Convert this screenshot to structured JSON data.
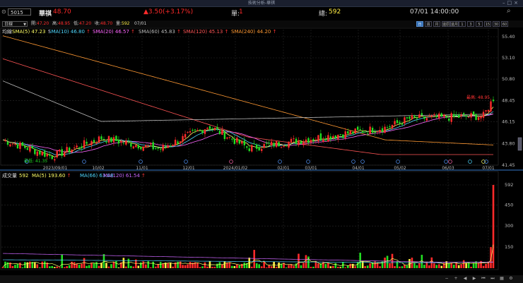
{
  "window": {
    "title": "技術分析-華祺"
  },
  "info": {
    "code": "5015",
    "name": "華祺",
    "price": "48.70",
    "change": "▲3.50(+3.17%)",
    "volume_label": "單:",
    "volume": "1",
    "total_label": "總:",
    "total": "592",
    "datetime": "07/01 14:00:00"
  },
  "ohlc": {
    "open_label": "開:",
    "open": "47.20",
    "high_label": "高:",
    "high": "48.95",
    "low_label": "低:",
    "low": "47.20",
    "close_label": "收:",
    "close": "48.70",
    "qty_label": "量:",
    "qty": "592",
    "date": "07/01"
  },
  "period": {
    "selected": "日線",
    "buttons": [
      "日",
      "週",
      "月",
      "還原",
      "還月",
      "1",
      "3",
      "5",
      "15",
      "30",
      "60"
    ],
    "active_index": 0
  },
  "ma_legend": {
    "label": "均線",
    "items": [
      {
        "text": "SMA(5) 47.23",
        "arrow": "↑",
        "color": "#ffff66"
      },
      {
        "text": "SMA(10) 46.80",
        "arrow": "↑",
        "color": "#4fd8ff"
      },
      {
        "text": "SMA(20) 46.57",
        "arrow": "↑",
        "color": "#ff66ff"
      },
      {
        "text": "SMA(60) 45.83",
        "arrow": "↑",
        "color": "#bbbbbb"
      },
      {
        "text": "SMA(120) 45.13",
        "arrow": "↑",
        "color": "#ff5555"
      },
      {
        "text": "SMA(240) 44.20",
        "arrow": "↑",
        "color": "#ff9933"
      }
    ]
  },
  "vol_legend": {
    "label": "成交量",
    "items": [
      {
        "text": "592",
        "color": "#ffff66"
      },
      {
        "text": "MA(5) 193.60",
        "arrow": "↑",
        "color": "#ffff66"
      },
      {
        "text": "MA(66) 63.08",
        "color": "#4fd8ff"
      },
      {
        "text": "MA(120) 61.54",
        "arrow": "↑",
        "color": "#cc66ff"
      }
    ]
  },
  "price_axis": [
    "55.40",
    "53.10",
    "50.80",
    "48.45",
    "46.15",
    "43.80",
    "41.45"
  ],
  "vol_axis": [
    "592",
    "450",
    "300",
    "150"
  ],
  "date_axis": [
    "2023/09/01",
    "10/02",
    "11/01",
    "12/01",
    "2024/01/02",
    "02/01",
    "03/01",
    "04/01",
    "05/02",
    "06/03",
    "07/01"
  ],
  "annotations": {
    "high": "最高: 48.95",
    "low": "最低: 41.35"
  },
  "footer_tools": [
    "zoom-out",
    "zoom-in",
    "left",
    "right",
    "first",
    "last",
    "calendar",
    "settings"
  ],
  "colors": {
    "up": "#ff2a2a",
    "down": "#22dd22",
    "flat": "#ffee44"
  }
}
